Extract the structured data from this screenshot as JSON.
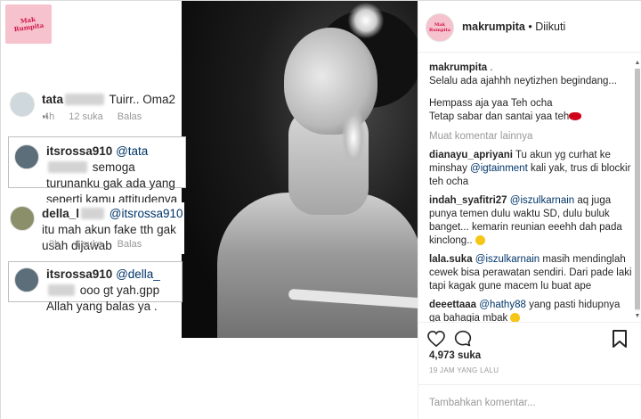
{
  "collage": {
    "logo_text": "Mak Rumpita",
    "cards": [
      {
        "name": "tata",
        "text": " Tuirr.. Oma2 ,,",
        "meta": [
          "4h",
          "12 suka",
          "Balas"
        ]
      },
      {
        "name": "itsrossa910",
        "mention": "@tata",
        "text": " semoga turunanku gak ada yang seperti kamu attitudenya .aamiiin"
      },
      {
        "name": "della_l",
        "mention": "@itsrossa910",
        "text": " itu mah akun fake tth gak usah dijawab",
        "meta": [
          "3h",
          "4 suka",
          "Balas"
        ]
      },
      {
        "name": "itsrossa910",
        "mention": "@della_",
        "text": " ooo gt yah.gpp Allah yang balas ya ."
      }
    ]
  },
  "header": {
    "avatar_text": "Mak Rumpita",
    "username": "makrumpita",
    "dot": " • ",
    "follow_status": "Diikuti"
  },
  "caption": {
    "username": "makrumpita",
    "suffix": " .",
    "lines": [
      "Selalu ada ajahhh neytizhen begindang...",
      "",
      "Hempass aja yaa Teh ocha",
      "Tetap sabar dan santai yaa teh"
    ]
  },
  "more_comments": "Muat komentar lainnya",
  "comments": [
    {
      "user": "dianayu_apriyani",
      "text": " Tu akun yg curhat ke minshay ",
      "mention": "@igtainment",
      "text2": " kali yak, trus di blockir teh ocha"
    },
    {
      "user": "indah_syafitri27",
      "text": " ",
      "mention": "@iszulkarnain",
      "text2": " aq juga punya temen dulu waktu SD, dulu buluk banget... kemarin reunian eeehh dah pada kinclong.. "
    },
    {
      "user": "lala.suka",
      "text": " ",
      "mention": "@iszulkarnain",
      "text2": " masih mendinglah cewek bisa perawatan sendiri. Dari pade laki tapi kagak gune macem lu buat ape"
    },
    {
      "user": "deeettaaa",
      "text": " ",
      "mention": "@hathy88",
      "text2": " yang pasti hidupnya ga bahagia mbak "
    }
  ],
  "icons": {
    "like": "heart-icon",
    "comment": "comment-icon",
    "save": "bookmark-icon",
    "scroll_up": "scroll-up-arrow",
    "scroll_down": "scroll-down-arrow"
  },
  "likes": "4,973 suka",
  "timestamp": "19 JAM YANG LALU",
  "add_comment": {
    "placeholder": "Tambahkan komentar..."
  },
  "colors": {
    "mention": "#003569",
    "muted": "#999999",
    "text": "#262626"
  }
}
